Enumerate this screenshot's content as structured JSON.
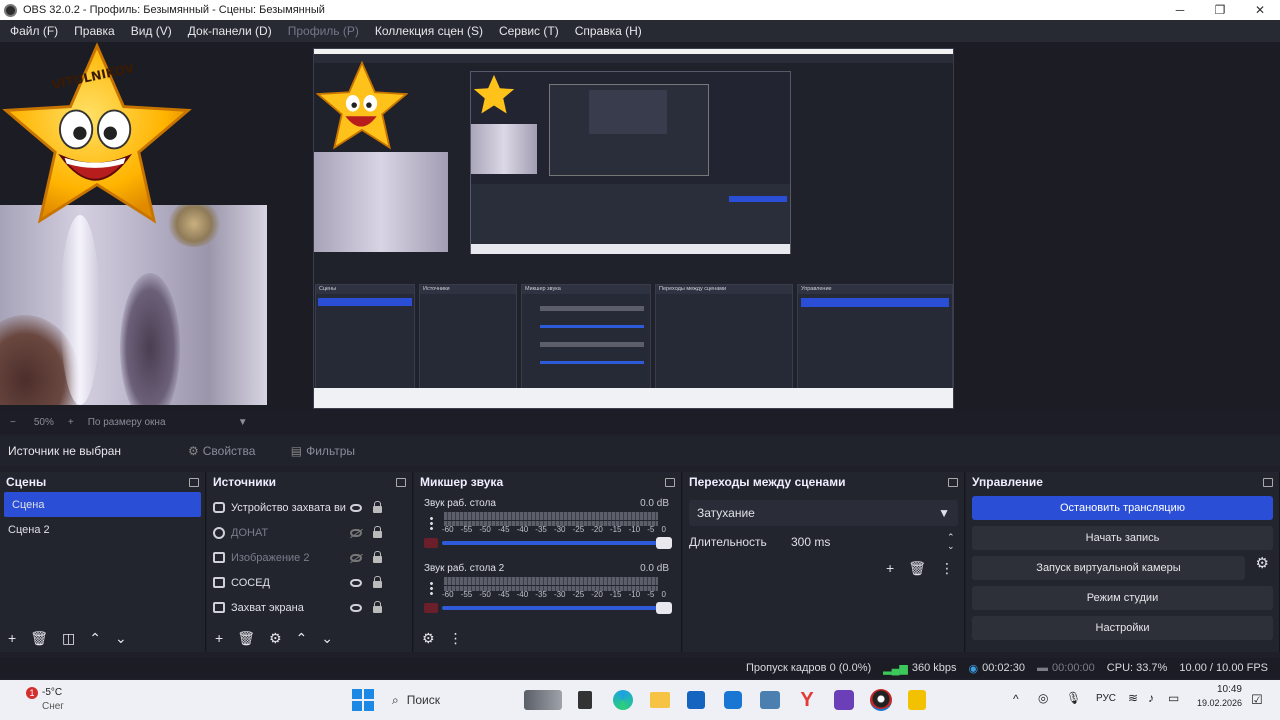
{
  "window": {
    "title": "OBS 32.0.2 - Профиль: Безымянный - Сцены: Безымянный"
  },
  "menu": [
    {
      "label": "Файл (F)",
      "disabled": false
    },
    {
      "label": "Правка",
      "disabled": false
    },
    {
      "label": "Вид (V)",
      "disabled": false
    },
    {
      "label": "Док-панели (D)",
      "disabled": false
    },
    {
      "label": "Профиль (P)",
      "disabled": true
    },
    {
      "label": "Коллекция сцен (S)",
      "disabled": false
    },
    {
      "label": "Сервис (T)",
      "disabled": false
    },
    {
      "label": "Справка (H)",
      "disabled": false
    }
  ],
  "preview": {
    "zoom": "50%",
    "fit_label": "По размеру окна",
    "star_overlay_text": "VITULNIKOV"
  },
  "source_bar": {
    "no_source": "Источник не выбран",
    "properties": "Свойства",
    "filters": "Фильтры"
  },
  "scenes": {
    "title": "Сцены",
    "items": [
      "Сцена",
      "Сцена 2"
    ],
    "selected": 0
  },
  "sources": {
    "title": "Источники",
    "items": [
      {
        "name": "Устройство захвата ви",
        "icon": "camera-icon",
        "visible": true
      },
      {
        "name": "ДОНАТ",
        "icon": "browser-icon",
        "visible": false
      },
      {
        "name": "Изображение 2",
        "icon": "image-icon",
        "visible": false
      },
      {
        "name": "СОСЕД",
        "icon": "window-icon",
        "visible": true
      },
      {
        "name": "Захват экрана",
        "icon": "monitor-icon",
        "visible": true
      }
    ]
  },
  "mixer": {
    "title": "Микшер звука",
    "ticks": [
      "-60",
      "-55",
      "-50",
      "-45",
      "-40",
      "-35",
      "-30",
      "-25",
      "-20",
      "-15",
      "-10",
      "-5",
      "0"
    ],
    "channels": [
      {
        "name": "Звук раб. стола",
        "db": "0.0 dB"
      },
      {
        "name": "Звук раб. стола 2",
        "db": "0.0 dB"
      }
    ]
  },
  "transitions": {
    "title": "Переходы между сценами",
    "selected": "Затухание",
    "duration_label": "Длительность",
    "duration_value": "300 ms"
  },
  "controls": {
    "title": "Управление",
    "buttons": [
      "Остановить трансляцию",
      "Начать запись",
      "Запуск виртуальной камеры",
      "Режим студии",
      "Настройки"
    ]
  },
  "status": {
    "dropped": "Пропуск кадров 0 (0.0%)",
    "bitrate": "360 kbps",
    "stream_time": "00:02:30",
    "record_time": "00:00:00",
    "cpu": "CPU: 33.7%",
    "fps": "10.00 / 10.00 FPS"
  },
  "taskbar": {
    "weather_temp": "-5°C",
    "weather_desc": "Снег",
    "weather_badge": "1",
    "search": "Поиск",
    "lang": "РУС",
    "time": "10:49",
    "date": "19.02.2026"
  },
  "colors": {
    "accent": "#2a4fd6",
    "panel": "#22242e",
    "bg": "#1e1f29"
  }
}
